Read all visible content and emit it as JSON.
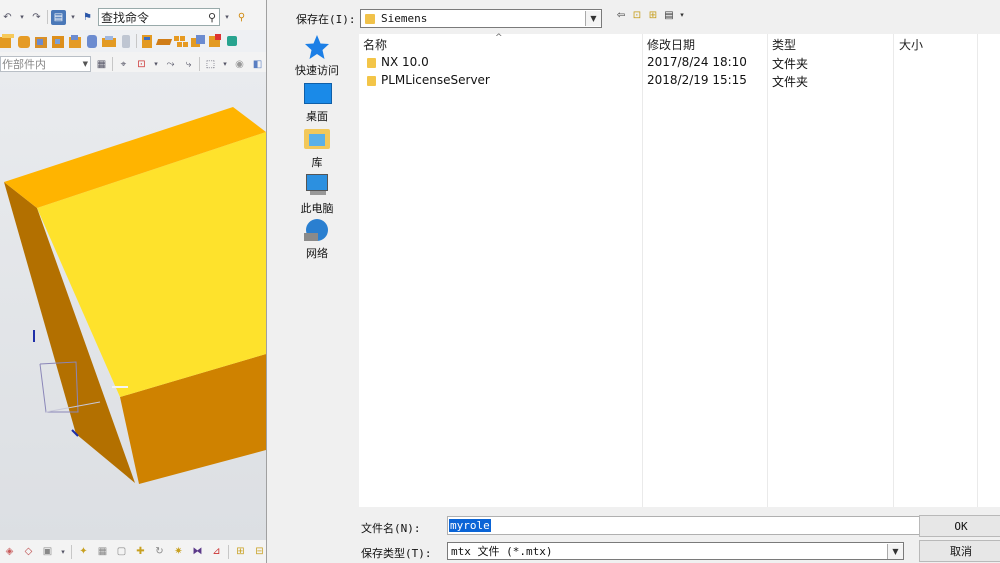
{
  "left_app": {
    "command_search_value": "查找命令",
    "part_filter_value": "作部件内"
  },
  "dialog": {
    "save_in_label": "保存在(I):",
    "save_in_value": "Siemens",
    "places": [
      {
        "label": "快速访问",
        "icon": "star-icon"
      },
      {
        "label": "桌面",
        "icon": "desktop-icon"
      },
      {
        "label": "库",
        "icon": "library-icon"
      },
      {
        "label": "此电脑",
        "icon": "computer-icon"
      },
      {
        "label": "网络",
        "icon": "network-icon"
      }
    ],
    "columns": [
      "名称",
      "修改日期",
      "类型",
      "大小"
    ],
    "files": [
      {
        "name": "NX 10.0",
        "date": "2017/8/24 18:10",
        "type": "文件夹"
      },
      {
        "name": "PLMLicenseServer",
        "date": "2018/2/19 15:15",
        "type": "文件夹"
      }
    ],
    "file_name_label": "文件名(N):",
    "file_name_value": "myrole",
    "file_type_label": "保存类型(T):",
    "file_type_value": "mtx 文件 (*.mtx)",
    "ok_label": "OK",
    "cancel_label": "取消"
  },
  "colors": {
    "model_top": "#fee22c",
    "model_side": "#cf8200",
    "model_left_face": "#b37000",
    "selection": "#0a64d6",
    "folder": "#f3c548"
  }
}
